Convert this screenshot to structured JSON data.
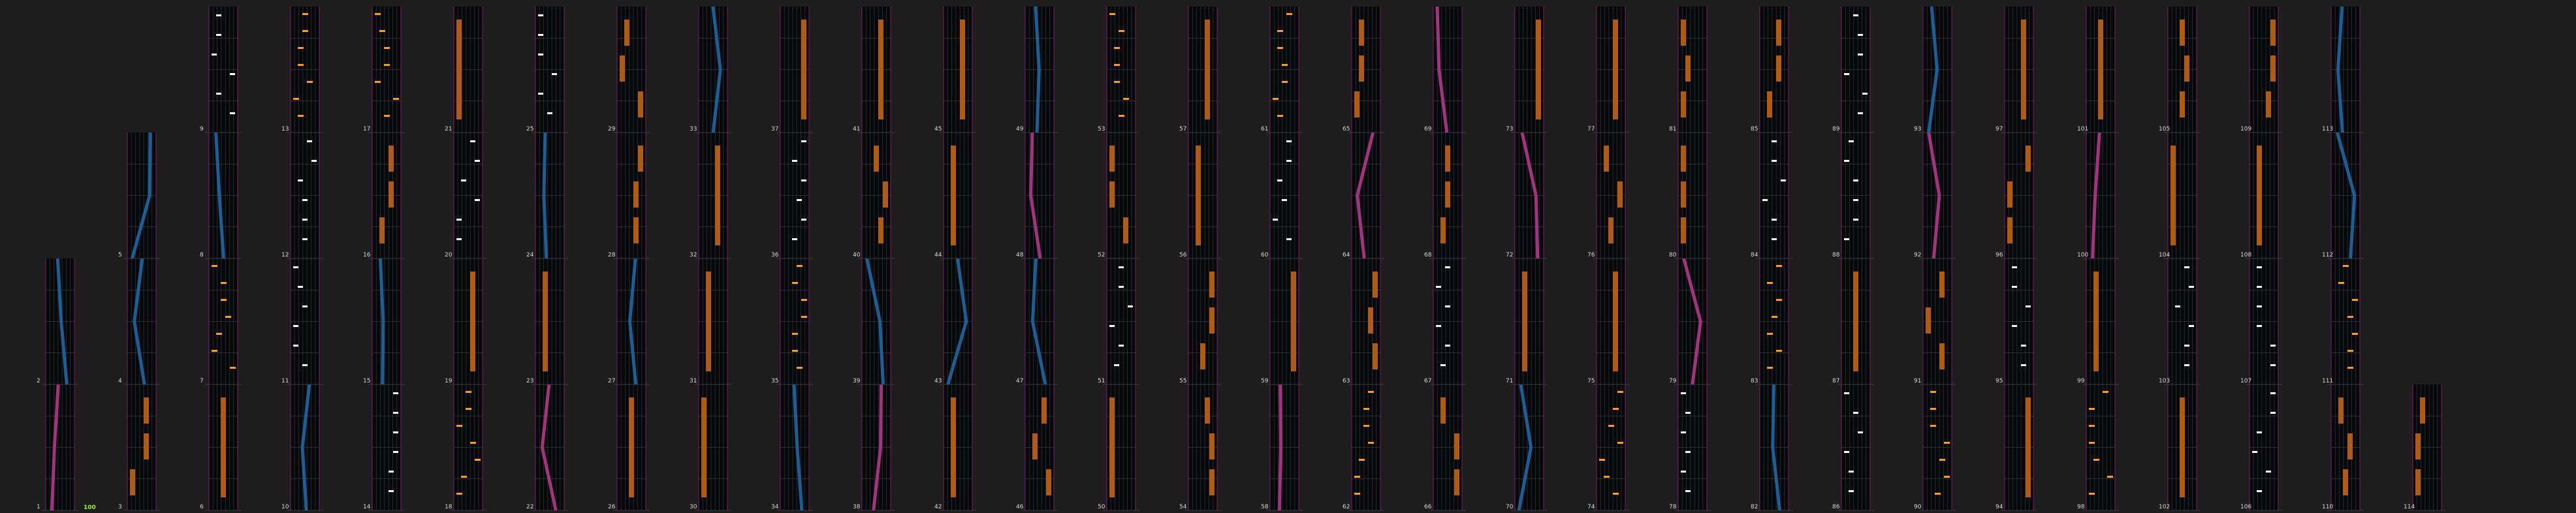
{
  "app": {
    "title": ""
  },
  "colors": {
    "background": "#1d1d1d",
    "lane_bg": "#080808",
    "lane_border": "#7a1f6a",
    "grid": "#1f2a3a",
    "beat_line": "#4c4c4c",
    "tap_note": "#ffffff",
    "hold_body": "#b05a14",
    "hold_edge": "#e07820",
    "flick": "#ff9d1a",
    "slide_blue": "#1b5f96",
    "slide_pink": "#a3337f",
    "combo_text": "#9cf22a"
  },
  "chart_data": {
    "type": "rhythm-chart",
    "measures": [
      "1",
      "2",
      "3",
      "4",
      "5",
      "6",
      "7",
      "8",
      "9",
      "10",
      "11",
      "12",
      "13",
      "14",
      "15",
      "16",
      "17",
      "18",
      "19",
      "20",
      "21",
      "22",
      "23",
      "24",
      "25",
      "26",
      "27",
      "28",
      "29",
      "30",
      "31",
      "32",
      "33",
      "34",
      "35",
      "36",
      "37",
      "38",
      "39",
      "40",
      "41",
      "42",
      "43",
      "44",
      "45",
      "46",
      "47",
      "48",
      "49",
      "50",
      "51",
      "52",
      "53",
      "54",
      "55",
      "56",
      "57",
      "58",
      "59",
      "60",
      "61",
      "62",
      "63",
      "64",
      "65",
      "66",
      "67",
      "68",
      "69",
      "70",
      "71",
      "72",
      "73",
      "74",
      "75",
      "76",
      "77",
      "78",
      "79",
      "80",
      "81",
      "82",
      "83",
      "84",
      "85",
      "86",
      "87",
      "88",
      "89",
      "90",
      "91",
      "92",
      "93",
      "94",
      "95",
      "96",
      "97",
      "98",
      "99",
      "100",
      "101",
      "102",
      "103",
      "104",
      "105",
      "106",
      "107",
      "108",
      "109",
      "110",
      "111",
      "112",
      "113",
      "114"
    ],
    "combo_label": "100"
  }
}
